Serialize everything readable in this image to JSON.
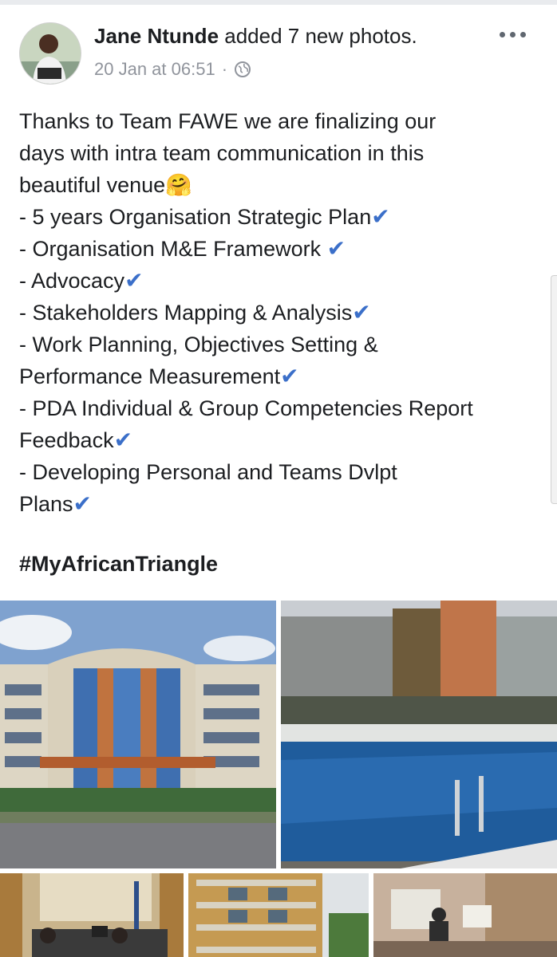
{
  "post": {
    "author": "Jane Ntunde",
    "action": "added 7 new photos.",
    "timestamp": "20 Jan at 06:51",
    "separator": "·",
    "privacy_icon": "globe-icon",
    "more_icon": "more-options-icon"
  },
  "body": {
    "lines": [
      {
        "text": "Thanks to Team FAWE we are finalizing our",
        "suffix": ""
      },
      {
        "text": "days with intra team communication in this",
        "suffix": ""
      },
      {
        "text": "beautiful venue",
        "suffix": "🤗"
      },
      {
        "text": "- 5 years Organisation Strategic Plan",
        "suffix": "✔"
      },
      {
        "text": "- Organisation M&E Framework ",
        "suffix": "✔"
      },
      {
        "text": "- Advocacy",
        "suffix": "✔"
      },
      {
        "text": "- Stakeholders Mapping & Analysis",
        "suffix": "✔"
      },
      {
        "text": "- Work Planning, Objectives Setting &",
        "suffix": ""
      },
      {
        "text": "Performance Measurement",
        "suffix": "✔"
      },
      {
        "text": "- PDA Individual & Group Competencies Report",
        "suffix": ""
      },
      {
        "text": "Feedback",
        "suffix": "✔"
      },
      {
        "text": "- Developing Personal and Teams Dvlpt",
        "suffix": ""
      },
      {
        "text": "Plans",
        "suffix": "✔"
      }
    ],
    "hashtag": "#MyAfricanTriangle"
  },
  "photos": [
    {
      "name": "hotel-building-photo"
    },
    {
      "name": "swimming-pool-photo"
    },
    {
      "name": "meeting-room-photo"
    },
    {
      "name": "hotel-facade-photo"
    },
    {
      "name": "presentation-room-photo"
    }
  ],
  "colors": {
    "check": "#3b6fc9",
    "meta_text": "#90949c",
    "text": "#1c1e21"
  }
}
